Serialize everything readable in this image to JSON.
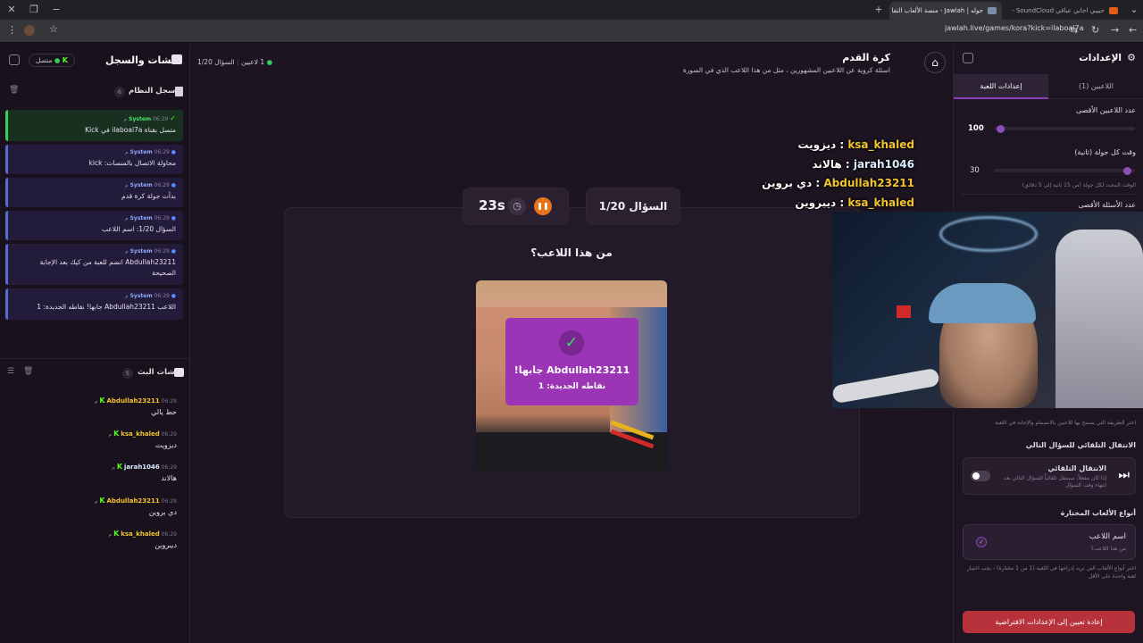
{
  "browser": {
    "tabs": [
      {
        "title": "جوله | Jawlah - منصة الألعاب التفا",
        "active": true
      },
      {
        "title": "حبيبي اجاني عباقي SoundCloud -",
        "active": false
      }
    ],
    "url": "jawlah.live/games/kora?kick=ilaboal7a"
  },
  "left_panel": {
    "title": "الشات والسجل",
    "status": "متصل",
    "system_log": {
      "title": "سجل النظام",
      "count": "6",
      "entries": [
        {
          "source": "System",
          "time": "06:29 م",
          "message": "متصل بقناة ilaboal7a في Kick"
        },
        {
          "source": "System",
          "time": "06:29 م",
          "message": "محاولة الاتصال بالمنصات: kick"
        },
        {
          "source": "System",
          "time": "06:29 م",
          "message": "بدأت جولة كرة قدم"
        },
        {
          "source": "System",
          "time": "06:29 م",
          "message": "السؤال 1/20: اسم اللاعب"
        },
        {
          "source": "System",
          "time": "06:29 م",
          "message": "Abdullah23211 انضم للعبة من كيك بعد الإجابة الصحيحة"
        },
        {
          "source": "System",
          "time": "06:29 م",
          "message": "اللاعب Abdullah23211 جابها! نقاطه الجديدة: 1"
        }
      ]
    },
    "live_chat": {
      "title": "شات البث",
      "count": "5",
      "messages": [
        {
          "user": "Abdullah23211",
          "time": "06:29 م",
          "message": "حط يالي",
          "color": "#f4c430"
        },
        {
          "user": "ksa_khaled",
          "time": "06:29 م",
          "message": "ديزويت",
          "color": "#f4c430"
        },
        {
          "user": "jarah1046",
          "time": "06:29 م",
          "message": "هالاند",
          "color": "#d9ecff"
        },
        {
          "user": "Abdullah23211",
          "time": "06:29 م",
          "message": "دي بروين",
          "color": "#f4c430"
        },
        {
          "user": "ksa_khaled",
          "time": "06:29 م",
          "message": "ديبروين",
          "color": "#f4c430"
        }
      ]
    }
  },
  "main": {
    "status": "1 لاعبين",
    "progress": "السؤال 1/20",
    "game_title": "كرة القدم",
    "game_subtitle": "اسئلة كروية عن اللاعبين المشهورين ، مثل من هذا اللاعب الذي في الصورة",
    "timer": "23s",
    "question_badge": "السؤال 1/20",
    "question": "من هذا اللاعب؟",
    "result": {
      "title": "Abdullah23211 جابها!",
      "points": "نقاطه الجديدة: 1"
    }
  },
  "right_panel": {
    "title": "الإعدادات",
    "tabs": [
      "إعدادات اللعبة",
      "اللاعبين (1)"
    ],
    "max_players_label": "عدد اللاعبين الأقصى",
    "max_players_value": "100",
    "max_players_fraction": 0.02,
    "round_time_label": "وقت كل جولة (ثانية)",
    "round_time_value": "30",
    "round_time_fraction": 0.97,
    "round_time_hint": "الوقت المحدد لكل جولة (من 15 ثانية إلى 5 دقائق)",
    "max_questions_label": "عدد الأسئلة الأقصى",
    "join_hint": "اختر الطريقة التي يسمح بها للاعبين بالانضمام والإجابة في اللعبة",
    "auto_next_heading": "الانتقال التلقائي للسؤال التالي",
    "auto_next_title": "الانتقال التلقائي",
    "auto_next_desc": "إذا كان مفعلاً، سينتقل تلقائياً للسؤال التالي بعد انتهاء وقت السؤال",
    "game_types_heading": "أنواع الألعاب المختارة",
    "game_type_name": "اسم اللاعب",
    "game_type_desc": "من هذا اللاعب؟",
    "game_types_hint": "اختر أنواع الألعاب التي تريد إدراجها في اللعبة (1 من 1 مختارة) - يجب اختيار لعبة واحدة على الأقل",
    "reset_button": "إعادة تعيين إلى الإعدادات الافتراضية"
  },
  "overlay_chat": [
    {
      "user": "ksa_khaled",
      "message": "ديزويت"
    },
    {
      "user": "jarah1046",
      "message": "هالاند"
    },
    {
      "user": "Abdullah23211",
      "message": "دي بروين"
    },
    {
      "user": "ksa_khaled",
      "message": "ديبروين"
    }
  ],
  "colors": {
    "accent": "#8a3fb8",
    "kick_green": "#53fc18",
    "timer_orange": "#e8741c",
    "reset_red": "#c0343c"
  }
}
